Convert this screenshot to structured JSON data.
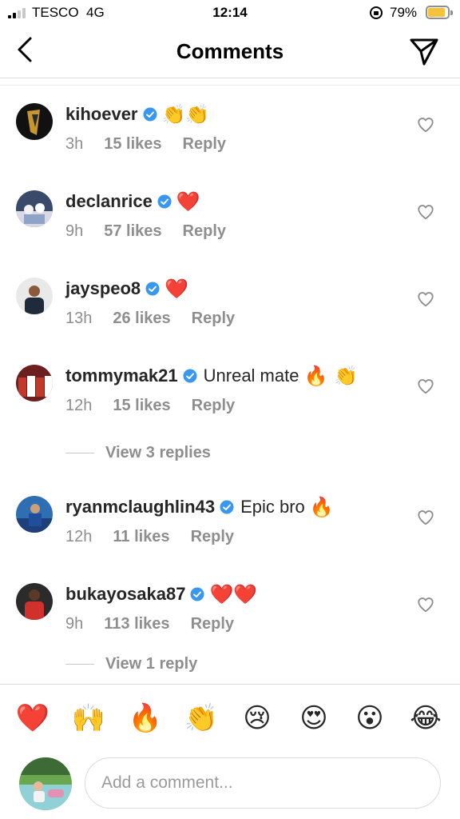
{
  "status_bar": {
    "carrier": "TESCO",
    "network": "4G",
    "time": "12:14",
    "battery_pct": "79%",
    "battery_fill": 0.79,
    "battery_color": "#f7c23b"
  },
  "header": {
    "title": "Comments"
  },
  "colors": {
    "verified": "#3897f0",
    "heart": "#ed4956",
    "muted": "#8e8e8e"
  },
  "comments": [
    {
      "username": "kihoever",
      "verified": true,
      "text": "",
      "emojis": "👏👏",
      "time": "3h",
      "likes": "15 likes",
      "reply": "Reply"
    },
    {
      "username": "declanrice",
      "verified": true,
      "text": "",
      "emojis": "❤️",
      "time": "9h",
      "likes": "57 likes",
      "reply": "Reply"
    },
    {
      "username": "jayspeo8",
      "verified": true,
      "text": "",
      "emojis": "❤️",
      "time": "13h",
      "likes": "26 likes",
      "reply": "Reply"
    },
    {
      "username": "tommymak21",
      "verified": true,
      "text": "Unreal mate",
      "emojis": "🔥 👏",
      "time": "12h",
      "likes": "15 likes",
      "reply": "Reply",
      "view_replies": "View 3 replies"
    },
    {
      "username": "ryanmclaughlin43",
      "verified": true,
      "text": "Epic bro",
      "emojis": "🔥",
      "time": "12h",
      "likes": "11 likes",
      "reply": "Reply"
    },
    {
      "username": "bukayosaka87",
      "verified": true,
      "text": "",
      "emojis": "❤️❤️",
      "time": "9h",
      "likes": "113 likes",
      "reply": "Reply",
      "view_replies": "View 1 reply"
    }
  ],
  "quick_emojis": [
    "❤️",
    "🙌",
    "🔥",
    "👏",
    "😢",
    "😍",
    "😮",
    "😂"
  ],
  "composer": {
    "placeholder": "Add a comment..."
  }
}
